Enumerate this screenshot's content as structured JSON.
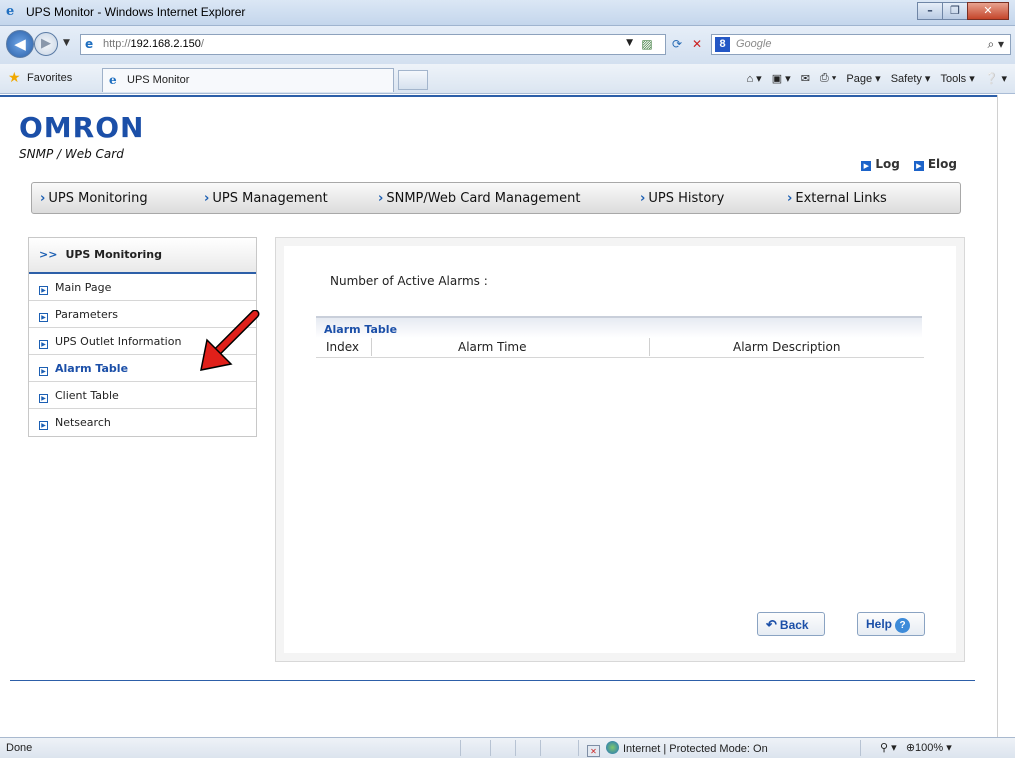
{
  "browser": {
    "window_title": "UPS Monitor - Windows Internet Explorer",
    "url_host": "http://192.168.2.150/",
    "url_prefix": "http://",
    "url_main": "192.168.2.150",
    "url_suffix": "/",
    "search_placeholder": "Google",
    "favorites_label": "Favorites",
    "tab_title": "UPS Monitor",
    "commands": {
      "page": "Page",
      "safety": "Safety",
      "tools": "Tools"
    }
  },
  "header": {
    "logo": "OMRON",
    "subtitle": "SNMP / Web Card",
    "links": [
      "Log",
      "Elog"
    ]
  },
  "menu": [
    "UPS Monitoring",
    "UPS Management",
    "SNMP/Web Card Management",
    "UPS History",
    "External Links"
  ],
  "sidebar": {
    "heading": "UPS Monitoring",
    "items": [
      {
        "label": "Main Page"
      },
      {
        "label": "Parameters"
      },
      {
        "label": "UPS Outlet Information"
      },
      {
        "label": "Alarm Table"
      },
      {
        "label": "Client Table"
      },
      {
        "label": "Netsearch"
      }
    ],
    "active_item": "Alarm Table"
  },
  "content": {
    "active_alarms_label": "Number of Active Alarms :",
    "table_title": "Alarm Table",
    "columns": [
      "Index",
      "Alarm Time",
      "Alarm Description"
    ],
    "rows": [],
    "back_label": "Back",
    "help_label": "Help"
  },
  "status": {
    "left": "Done",
    "zone": "Internet | Protected Mode: On",
    "zoom": "100%"
  },
  "colors": {
    "brand": "#1b4fa8",
    "accent_rule": "#2d5fa8",
    "annotation_arrow": "#e0201a"
  }
}
